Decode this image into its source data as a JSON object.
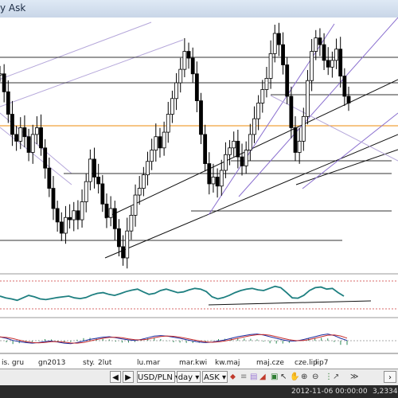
{
  "window": {
    "title": "y Ask"
  },
  "x_axis_labels": [
    "is. gru",
    "gn2013",
    "sty.",
    "2lut",
    "lu.mar",
    "mar.kwi",
    "kw.maj",
    "maj.cze",
    "cze.lip",
    "lip7"
  ],
  "toolbar": {
    "left_scroll_icon": "triangle-left-icon",
    "right_scroll_icon": "triangle-right-icon",
    "symbol": "USD/PLN",
    "timeframe": "day",
    "price_type": "ASK",
    "tools": [
      "candle-icon",
      "chart-type-icon",
      "bar-chart-icon",
      "drawing-icon",
      "add-icon",
      "cursor-icon",
      "hand-icon",
      "zoom-in-icon",
      "zoom-out-icon",
      "dots-icon",
      "fit-icon"
    ],
    "right_arrow_icon": "chevron-right-icon"
  },
  "status": {
    "datetime": "2012-11-06 00:00:00",
    "price": "3,2334"
  },
  "colors": {
    "candle": "#000000",
    "channel_purple": "#8a6fcf",
    "channel_light": "#b5a7da",
    "horizontal_orange": "#f0a23c",
    "rsi_line": "#1e7f80",
    "macd_line": "#1b2ca0",
    "signal_line": "#c62e2e"
  },
  "chart_data": {
    "type": "candlestick",
    "symbol": "USD/PLN",
    "timeframe": "day",
    "price_shape_closes": [
      0.82,
      0.74,
      0.64,
      0.55,
      0.52,
      0.58,
      0.54,
      0.47,
      0.55,
      0.58,
      0.49,
      0.4,
      0.31,
      0.22,
      0.16,
      0.11,
      0.18,
      0.17,
      0.21,
      0.17,
      0.25,
      0.34,
      0.44,
      0.36,
      0.33,
      0.24,
      0.18,
      0.22,
      0.13,
      0.05,
      0.0,
      0.12,
      0.19,
      0.28,
      0.31,
      0.37,
      0.43,
      0.48,
      0.54,
      0.49,
      0.56,
      0.64,
      0.71,
      0.78,
      0.84,
      0.92,
      0.89,
      0.82,
      0.7,
      0.55,
      0.42,
      0.33,
      0.36,
      0.32,
      0.39,
      0.46,
      0.49,
      0.52,
      0.45,
      0.41,
      0.48,
      0.55,
      0.62,
      0.69,
      0.75,
      0.8,
      0.91,
      1.0,
      0.95,
      0.86,
      0.72,
      0.58,
      0.47,
      0.52,
      0.63,
      0.79,
      0.92,
      0.98,
      0.95,
      0.88,
      0.85,
      0.88,
      0.93,
      0.81,
      0.72,
      0.69
    ],
    "rsi_shape": [
      0.5,
      0.45,
      0.42,
      0.38,
      0.45,
      0.52,
      0.48,
      0.42,
      0.4,
      0.43,
      0.46,
      0.48,
      0.5,
      0.45,
      0.43,
      0.46,
      0.53,
      0.58,
      0.6,
      0.55,
      0.52,
      0.57,
      0.63,
      0.67,
      0.7,
      0.62,
      0.55,
      0.58,
      0.66,
      0.7,
      0.65,
      0.6,
      0.62,
      0.68,
      0.72,
      0.7,
      0.63,
      0.48,
      0.42,
      0.46,
      0.52,
      0.6,
      0.66,
      0.7,
      0.72,
      0.68,
      0.66,
      0.72,
      0.78,
      0.74,
      0.6,
      0.45,
      0.44,
      0.52,
      0.66,
      0.74,
      0.76,
      0.7,
      0.72,
      0.6,
      0.5
    ],
    "macd_shape": [
      0.55,
      0.5,
      0.42,
      0.38,
      0.34,
      0.32,
      0.34,
      0.38,
      0.4,
      0.36,
      0.32,
      0.3,
      0.34,
      0.4,
      0.46,
      0.5,
      0.54,
      0.56,
      0.52,
      0.48,
      0.44,
      0.42,
      0.46,
      0.52,
      0.58,
      0.6,
      0.58,
      0.54,
      0.5,
      0.45,
      0.4,
      0.36,
      0.34,
      0.36,
      0.4,
      0.44,
      0.5,
      0.56,
      0.6,
      0.64,
      0.66,
      0.62,
      0.56,
      0.5,
      0.44,
      0.4,
      0.4,
      0.44,
      0.5,
      0.56,
      0.62,
      0.66,
      0.6,
      0.5,
      0.42
    ]
  }
}
